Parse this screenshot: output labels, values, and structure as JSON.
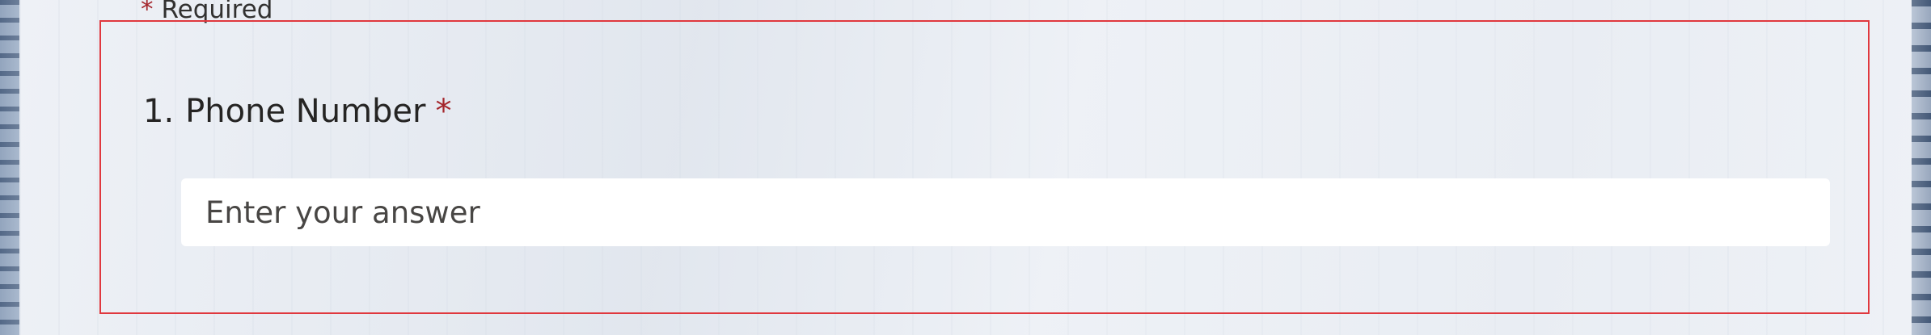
{
  "form": {
    "required_note": {
      "star": "*",
      "text": "Required"
    },
    "question": {
      "number": "1.",
      "title": "Phone Number",
      "required_star": "*",
      "input_value": "",
      "input_placeholder": "Enter your answer"
    }
  },
  "colors": {
    "required_star": "#a4262c",
    "highlight_border": "#e0383e",
    "input_background": "#ffffff"
  }
}
